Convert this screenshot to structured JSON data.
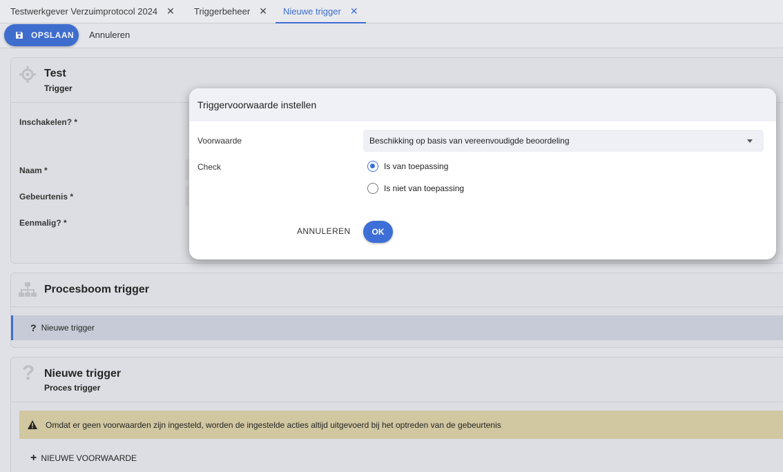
{
  "tabs": [
    {
      "label": "Testwerkgever Verzuimprotocol 2024"
    },
    {
      "label": "Triggerbeheer"
    },
    {
      "label": "Nieuwe trigger"
    }
  ],
  "toolbar": {
    "save_label": "OPSLAAN",
    "cancel_label": "Annuleren"
  },
  "trigger_card": {
    "title": "Test",
    "subtitle": "Trigger",
    "fields": {
      "enable": "Inschakelen?",
      "name": "Naam",
      "event": "Gebeurtenis",
      "once": "Eenmalig?"
    },
    "required_marker": "*"
  },
  "tree_card": {
    "title": "Procesboom trigger",
    "item_icon": "?",
    "item_label": "Nieuwe trigger"
  },
  "process_card": {
    "icon": "?",
    "title": "Nieuwe trigger",
    "subtitle": "Proces trigger",
    "alert_text": "Omdat er geen voorwaarden zijn ingesteld, worden de ingestelde acties altijd uitgevoerd bij het optreden van de gebeurtenis",
    "add_condition_label": "NIEUWE VOORWAARDE"
  },
  "dialog": {
    "title": "Triggervoorwaarde instellen",
    "condition_label": "Voorwaarde",
    "condition_value": "Beschikking op basis van vereenvoudigde beoordeling",
    "check_label": "Check",
    "options": [
      {
        "label": "Is van toepassing",
        "checked": true
      },
      {
        "label": "Is niet van toepassing",
        "checked": false
      }
    ],
    "cancel_label": "ANNULEREN",
    "ok_label": "OK"
  },
  "colors": {
    "accent": "#3d6fd6",
    "alert": "#d9cfa5"
  }
}
